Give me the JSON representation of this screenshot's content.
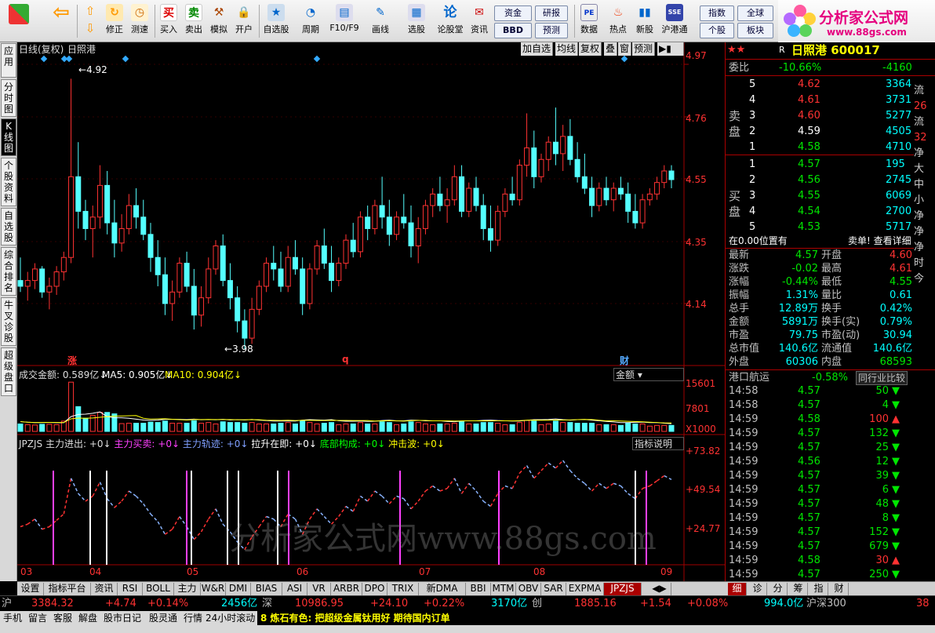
{
  "toolbar": {
    "buttons": [
      "修正",
      "测速",
      "买入",
      "卖出",
      "模拟",
      "开户",
      "自选股",
      "周期",
      "F10/F9",
      "画线",
      "选股",
      "论股堂",
      "资讯",
      "数据",
      "热点",
      "新股",
      "沪港通"
    ],
    "boxes": [
      "资金",
      "研报",
      "BBD",
      "预测",
      "指数",
      "全球",
      "个股",
      "板块"
    ],
    "logo_title": "分析家公式网",
    "logo_url": "www.88gs.com"
  },
  "left_tabs": [
    "应用",
    "分时图",
    "K线图",
    "个股资料",
    "自选股",
    "综合排名",
    "牛叉诊股",
    "超级盘口"
  ],
  "chart": {
    "period_label": "日线(复权)",
    "stock_name": "日照港",
    "header_buttons": [
      "加自选",
      "均线",
      "复权",
      "叠",
      "窗",
      "预测"
    ],
    "price_axis": [
      "4.97",
      "4.76",
      "4.55",
      "4.35",
      "4.14"
    ],
    "high_label": "4.92",
    "low_label": "3.98",
    "date_labels": [
      "03",
      "04",
      "05",
      "06",
      "07",
      "08",
      "09"
    ],
    "markers": [
      "涨",
      "q",
      "财"
    ],
    "volume_header": {
      "label": "成交金额: 0.589亿↓",
      "ma5": "MA5: 0.905亿↓",
      "ma10": "MA10: 0.904亿↓",
      "selector": "金额"
    },
    "volume_axis": [
      "15601",
      "7801",
      "X1000"
    ],
    "indicator_header": {
      "name": "JPZJS",
      "s1": "主力进出: +0↓",
      "s2": "主力买卖: +0↓",
      "s3": "主力轨迹: +0↓",
      "s4": "拉升在即: +0↓",
      "s5": "底部构成: +0↓",
      "s6": "冲击波: +0↓",
      "help": "指标说明"
    },
    "indicator_axis": [
      "+73.82",
      "+49.54",
      "+24.77"
    ],
    "watermark": "分析家公式网www.88gs.com",
    "candles": [
      [
        4.22,
        4.3,
        4.18,
        4.2
      ],
      [
        4.2,
        4.25,
        4.15,
        4.22
      ],
      [
        4.22,
        4.28,
        4.19,
        4.26
      ],
      [
        4.26,
        4.27,
        4.16,
        4.18
      ],
      [
        4.18,
        4.23,
        4.12,
        4.2
      ],
      [
        4.2,
        4.27,
        4.17,
        4.25
      ],
      [
        4.25,
        4.32,
        4.22,
        4.3
      ],
      [
        4.3,
        4.92,
        4.28,
        4.58
      ],
      [
        4.58,
        4.7,
        4.4,
        4.46
      ],
      [
        4.46,
        4.5,
        4.36,
        4.4
      ],
      [
        4.4,
        4.48,
        4.3,
        4.44
      ],
      [
        4.44,
        4.62,
        4.4,
        4.55
      ],
      [
        4.55,
        4.6,
        4.38,
        4.42
      ],
      [
        4.42,
        4.5,
        4.3,
        4.35
      ],
      [
        4.35,
        4.45,
        4.32,
        4.4
      ],
      [
        4.4,
        4.52,
        4.38,
        4.48
      ],
      [
        4.48,
        4.54,
        4.4,
        4.44
      ],
      [
        4.44,
        4.5,
        4.36,
        4.38
      ],
      [
        4.38,
        4.42,
        4.25,
        4.3
      ],
      [
        4.3,
        4.36,
        4.2,
        4.24
      ],
      [
        4.24,
        4.3,
        4.1,
        4.14
      ],
      [
        4.14,
        4.22,
        4.08,
        4.18
      ],
      [
        4.18,
        4.3,
        4.16,
        4.28
      ],
      [
        4.28,
        4.32,
        4.18,
        4.2
      ],
      [
        4.2,
        4.26,
        4.05,
        4.1
      ],
      [
        4.1,
        4.2,
        4.06,
        4.16
      ],
      [
        4.16,
        4.3,
        4.14,
        4.26
      ],
      [
        4.26,
        4.36,
        4.24,
        4.34
      ],
      [
        4.34,
        4.38,
        4.2,
        4.22
      ],
      [
        4.22,
        4.28,
        4.12,
        4.16
      ],
      [
        4.16,
        4.2,
        4.04,
        4.08
      ],
      [
        4.08,
        4.12,
        3.98,
        4.02
      ],
      [
        4.02,
        4.16,
        4.0,
        4.12
      ],
      [
        4.12,
        4.22,
        4.1,
        4.2
      ],
      [
        4.2,
        4.3,
        4.18,
        4.28
      ],
      [
        4.28,
        4.34,
        4.22,
        4.26
      ],
      [
        4.26,
        4.32,
        4.18,
        4.2
      ],
      [
        4.2,
        4.34,
        4.18,
        4.3
      ],
      [
        4.3,
        4.36,
        4.24,
        4.26
      ],
      [
        4.26,
        4.3,
        4.1,
        4.14
      ],
      [
        4.14,
        4.28,
        4.12,
        4.26
      ],
      [
        4.26,
        4.36,
        4.24,
        4.34
      ],
      [
        4.34,
        4.4,
        4.26,
        4.28
      ],
      [
        4.28,
        4.34,
        4.18,
        4.22
      ],
      [
        4.22,
        4.3,
        4.2,
        4.28
      ],
      [
        4.28,
        4.38,
        4.26,
        4.36
      ],
      [
        4.36,
        4.42,
        4.3,
        4.32
      ],
      [
        4.32,
        4.46,
        4.3,
        4.44
      ],
      [
        4.44,
        4.48,
        4.36,
        4.4
      ],
      [
        4.4,
        4.5,
        4.38,
        4.48
      ],
      [
        4.48,
        4.58,
        4.4,
        4.44
      ],
      [
        4.44,
        4.5,
        4.34,
        4.38
      ],
      [
        4.38,
        4.46,
        4.36,
        4.44
      ],
      [
        4.44,
        4.52,
        4.4,
        4.42
      ],
      [
        4.42,
        4.48,
        4.3,
        4.34
      ],
      [
        4.34,
        4.44,
        4.28,
        4.4
      ],
      [
        4.4,
        4.5,
        4.38,
        4.48
      ],
      [
        4.48,
        4.54,
        4.44,
        4.52
      ],
      [
        4.52,
        4.58,
        4.46,
        4.48
      ],
      [
        4.48,
        4.54,
        4.42,
        4.5
      ],
      [
        4.5,
        4.62,
        4.48,
        4.58
      ],
      [
        4.58,
        4.62,
        4.44,
        4.46
      ],
      [
        4.46,
        4.56,
        4.44,
        4.54
      ],
      [
        4.54,
        4.58,
        4.46,
        4.48
      ],
      [
        4.48,
        4.52,
        4.36,
        4.4
      ],
      [
        4.4,
        4.48,
        4.32,
        4.36
      ],
      [
        4.36,
        4.48,
        4.34,
        4.46
      ],
      [
        4.46,
        4.54,
        4.44,
        4.52
      ],
      [
        4.52,
        4.58,
        4.48,
        4.5
      ],
      [
        4.5,
        4.64,
        4.48,
        4.62
      ],
      [
        4.62,
        4.8,
        4.58,
        4.68
      ],
      [
        4.68,
        4.74,
        4.54,
        4.58
      ],
      [
        4.58,
        4.66,
        4.56,
        4.64
      ],
      [
        4.64,
        4.72,
        4.6,
        4.7
      ],
      [
        4.7,
        4.82,
        4.62,
        4.66
      ],
      [
        4.66,
        4.76,
        4.6,
        4.72
      ],
      [
        4.72,
        4.78,
        4.62,
        4.64
      ],
      [
        4.64,
        4.7,
        4.56,
        4.58
      ],
      [
        4.58,
        4.66,
        4.52,
        4.54
      ],
      [
        4.54,
        4.58,
        4.44,
        4.48
      ],
      [
        4.48,
        4.56,
        4.46,
        4.54
      ],
      [
        4.54,
        4.58,
        4.48,
        4.5
      ],
      [
        4.5,
        4.56,
        4.46,
        4.54
      ],
      [
        4.54,
        4.58,
        4.5,
        4.52
      ],
      [
        4.52,
        4.56,
        4.42,
        4.46
      ],
      [
        4.46,
        4.52,
        4.4,
        4.42
      ],
      [
        4.42,
        4.52,
        4.4,
        4.5
      ],
      [
        4.5,
        4.54,
        4.48,
        4.52
      ],
      [
        4.52,
        4.58,
        4.5,
        4.56
      ],
      [
        4.56,
        4.62,
        4.54,
        4.6
      ],
      [
        4.6,
        4.62,
        4.54,
        4.57
      ]
    ]
  },
  "quote": {
    "title": "日照港 600017",
    "weibi_label": "委比",
    "weibi_pct": "-10.66%",
    "weibi_val": "-4160",
    "sell_label": "卖盘",
    "buy_label": "买盘",
    "sell": [
      [
        "5",
        "4.62",
        "3364"
      ],
      [
        "4",
        "4.61",
        "3731"
      ],
      [
        "3",
        "4.60",
        "5277"
      ],
      [
        "2",
        "4.59",
        "4505"
      ],
      [
        "1",
        "4.58",
        "4710"
      ]
    ],
    "buy": [
      [
        "1",
        "4.57",
        "195"
      ],
      [
        "2",
        "4.56",
        "2745"
      ],
      [
        "3",
        "4.55",
        "6069"
      ],
      [
        "4",
        "4.54",
        "2700"
      ],
      [
        "5",
        "4.53",
        "5717"
      ]
    ],
    "pos_note": "在0.00位置有",
    "pos_link": "卖单! 查看详细",
    "stats": [
      [
        "最新",
        "4.57",
        "开盘",
        "4.60"
      ],
      [
        "涨跌",
        "-0.02",
        "最高",
        "4.61"
      ],
      [
        "涨幅",
        "-0.44%",
        "最低",
        "4.55"
      ],
      [
        "振幅",
        "1.31%",
        "量比",
        "0.61"
      ],
      [
        "总手",
        "12.89万",
        "换手",
        "0.42%"
      ],
      [
        "金额",
        "5891万",
        "换手(实)",
        "0.79%"
      ],
      [
        "市盈",
        "79.75",
        "市盈(动)",
        "30.94"
      ],
      [
        "总市值",
        "140.6亿",
        "流通值",
        "140.6亿"
      ],
      [
        "外盘",
        "60306",
        "内盘",
        "68593"
      ]
    ],
    "sector": "港口航运",
    "sector_pct": "-0.58%",
    "sector_btn": "同行业比较",
    "ticks": [
      [
        "14:58",
        "4.57",
        "50"
      ],
      [
        "14:58",
        "4.57",
        "4"
      ],
      [
        "14:59",
        "4.58",
        "100"
      ],
      [
        "14:59",
        "4.57",
        "132"
      ],
      [
        "14:59",
        "4.57",
        "25"
      ],
      [
        "14:59",
        "4.56",
        "12"
      ],
      [
        "14:59",
        "4.57",
        "39"
      ],
      [
        "14:59",
        "4.57",
        "6"
      ],
      [
        "14:59",
        "4.57",
        "48"
      ],
      [
        "14:59",
        "4.57",
        "8"
      ],
      [
        "14:59",
        "4.57",
        "152"
      ],
      [
        "14:59",
        "4.57",
        "679"
      ],
      [
        "14:59",
        "4.58",
        "30"
      ],
      [
        "14:59",
        "4.57",
        "250"
      ]
    ],
    "right_strip": [
      "流",
      "26",
      "流",
      "32",
      "净",
      "大",
      "中",
      "小",
      "净",
      "净",
      "净",
      "时",
      "今"
    ]
  },
  "bottom_tabs": [
    "设置",
    "指标平台",
    "资讯",
    "RSI",
    "BOLL",
    "主力",
    "W&R",
    "DMI",
    "BIAS",
    "ASI",
    "VR",
    "ARBR",
    "DPO",
    "TRIX",
    "新DMA",
    "BBI",
    "MTM",
    "OBV",
    "SAR",
    "EXPMA",
    "JPZJS"
  ],
  "bottom_right_tabs": [
    "细",
    "诊",
    "分",
    "筹",
    "指",
    "财"
  ],
  "index": {
    "sh_label": "沪",
    "sh_val": "3384.32",
    "sh_chg": "+4.74",
    "sh_pct": "+0.14%",
    "sh_amt": "2456亿",
    "sz_label": "深",
    "sz_val": "10986.95",
    "sz_chg": "+24.10",
    "sz_pct": "+0.22%",
    "sz_amt": "3170亿",
    "cy_label": "创",
    "cy_val": "1885.16",
    "cy_chg": "+1.54",
    "cy_pct": "+0.08%",
    "hgt_amt": "994.0亿",
    "hgt_label": "沪深300",
    "last": "38"
  },
  "status": {
    "items": [
      "手机",
      "留言",
      "客服",
      "解盘",
      "股市日记",
      "股灵通",
      "行情",
      "24小时滚动"
    ],
    "news": "8 炼石有色: 把超级金属钛用好 期待国内订单"
  },
  "colors": {
    "up": "#ff3232",
    "down": "#54ffff",
    "bg": "#000000",
    "axis": "#a00000"
  }
}
